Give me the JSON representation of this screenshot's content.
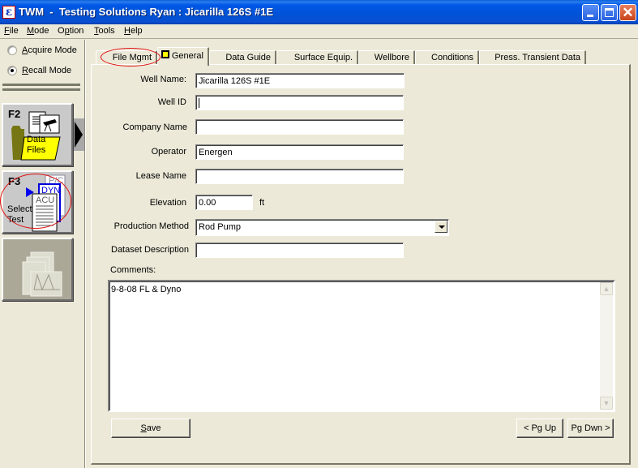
{
  "window": {
    "app_icon": "twm-app-icon",
    "title": "TWM  -  Testing Solutions Ryan : Jicarilla 126S #1E",
    "controls": [
      "minimize",
      "maximize",
      "close"
    ]
  },
  "menu": {
    "items": [
      {
        "label": "File",
        "accel": "F",
        "rest": "ile"
      },
      {
        "label": "Mode",
        "accel": "M",
        "rest": "ode"
      },
      {
        "label": "Option",
        "pre": "O",
        "accel": "p",
        "rest": "tion"
      },
      {
        "label": "Tools",
        "accel": "T",
        "rest": "ools"
      },
      {
        "label": "Help",
        "accel": "H",
        "rest": "elp"
      }
    ]
  },
  "sidebar": {
    "modes": [
      {
        "label": "Acquire Mode",
        "accel": "A",
        "rest": "cquire Mode",
        "checked": false
      },
      {
        "label": "Recall Mode",
        "accel": "R",
        "rest": "ecall Mode",
        "checked": true
      }
    ],
    "buttons": [
      {
        "key": "F2",
        "label_line1": "Data",
        "label_line2": "Files",
        "icon": "data-files-folder-icon"
      },
      {
        "key": "F3",
        "label_line1": "Select",
        "label_line2": "Test",
        "docs": [
          "P/C",
          "DYN",
          "ACU"
        ],
        "icon": "select-test-icon"
      },
      {
        "key": "",
        "icon": "analysis-report-icon",
        "enabled": false
      }
    ]
  },
  "tabs": [
    {
      "label": "File Mgmt",
      "active": false
    },
    {
      "label": "General",
      "active": true
    },
    {
      "label": "Data Guide",
      "active": false
    },
    {
      "label": "Surface Equip.",
      "active": false
    },
    {
      "label": "Wellbore",
      "active": false
    },
    {
      "label": "Conditions",
      "active": false
    },
    {
      "label": "Press. Transient Data",
      "active": false
    }
  ],
  "form": {
    "well_name": {
      "label": "Well Name:",
      "value": "Jicarilla 126S #1E"
    },
    "well_id": {
      "label": "Well ID",
      "value": ""
    },
    "company_name": {
      "label": "Company Name",
      "value": ""
    },
    "operator": {
      "label": "Operator",
      "value": "Energen"
    },
    "lease_name": {
      "label": "Lease Name",
      "value": ""
    },
    "elevation": {
      "label": "Elevation",
      "value": "0.00",
      "unit": "ft"
    },
    "production_method": {
      "label": "Production Method",
      "value": "Rod Pump"
    },
    "dataset_description": {
      "label": "Dataset Description",
      "value": ""
    },
    "comments": {
      "label": "Comments:",
      "value": "9-8-08 FL & Dyno"
    }
  },
  "buttons": {
    "save": {
      "label": "Save",
      "accel": "S",
      "rest": "ave"
    },
    "pg_up": "< Pg Up",
    "pg_dwn": "Pg Dwn >"
  },
  "colors": {
    "titlebar": "#0054e3",
    "face": "#ece9d8",
    "annotation_red": "#e01010",
    "tab_indicator": "#ffff00"
  }
}
